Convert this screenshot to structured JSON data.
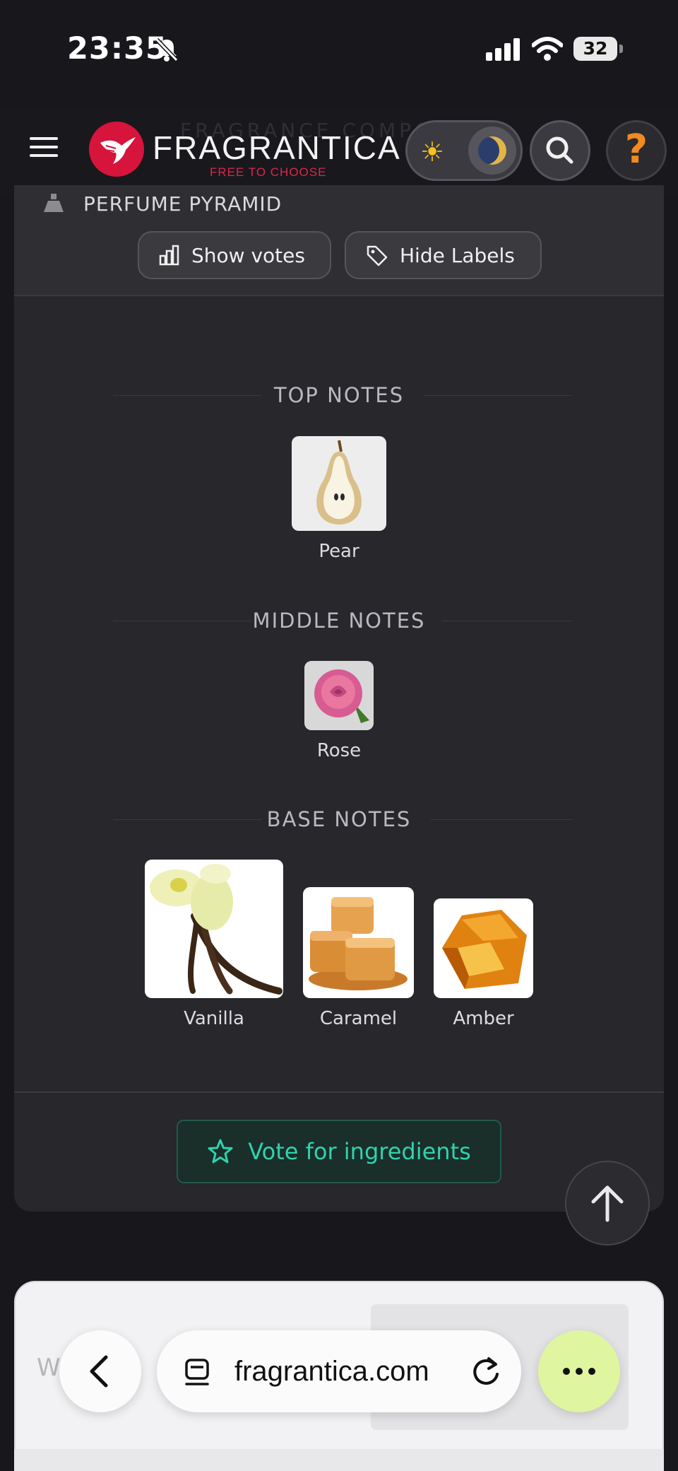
{
  "status": {
    "time": "23:35",
    "battery": "32"
  },
  "header": {
    "ghost_title": "FRAGRANCE COMPO",
    "logo_name": "FRAGRANTICA",
    "logo_tagline": "FREE TO CHOOSE",
    "sun_glyph": "☀",
    "avatar_glyph": "?"
  },
  "pyramid": {
    "title": "PERFUME PYRAMID",
    "show_votes_label": "Show votes",
    "hide_labels_label": "Hide Labels",
    "sections": {
      "top": {
        "title": "TOP NOTES",
        "notes": [
          {
            "name": "Pear"
          }
        ]
      },
      "middle": {
        "title": "MIDDLE NOTES",
        "notes": [
          {
            "name": "Rose"
          }
        ]
      },
      "base": {
        "title": "BASE NOTES",
        "notes": [
          {
            "name": "Vanilla"
          },
          {
            "name": "Caramel"
          },
          {
            "name": "Amber"
          }
        ]
      }
    },
    "vote_button_label": "Vote for ingredients"
  },
  "browser": {
    "url": "fragrantica.com",
    "ghost_text": "Write yo"
  },
  "colors": {
    "accent_teal": "#2fd3ad",
    "brand_red": "#d6143c",
    "background": "#17171c"
  }
}
